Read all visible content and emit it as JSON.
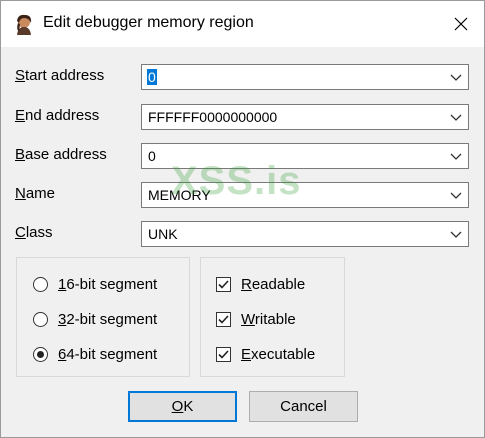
{
  "window": {
    "title": "Edit debugger memory region",
    "icon": "app-avatar-icon",
    "close_icon": "close-icon"
  },
  "fields": {
    "start": {
      "label_accel": "S",
      "label_rest": "tart address",
      "value": "0"
    },
    "end": {
      "label_accel": "E",
      "label_rest": "nd address",
      "value": "FFFFFF0000000000"
    },
    "base": {
      "label_accel": "B",
      "label_rest": "ase address",
      "value": "0"
    },
    "name": {
      "label_accel": "N",
      "label_rest": "ame",
      "value": "MEMORY"
    },
    "class": {
      "label_accel": "C",
      "label_rest": "lass",
      "value": "UNK"
    }
  },
  "segments": {
    "options": [
      {
        "accel": "1",
        "rest": "6-bit segment",
        "selected": false
      },
      {
        "accel": "3",
        "rest": "2-bit segment",
        "selected": false
      },
      {
        "accel": "6",
        "rest": "4-bit segment",
        "selected": true
      }
    ]
  },
  "permissions": {
    "options": [
      {
        "accel": "R",
        "rest": "eadable",
        "checked": true
      },
      {
        "accel": "W",
        "rest": "ritable",
        "checked": true
      },
      {
        "accel": "E",
        "rest": "xecutable",
        "checked": true
      }
    ]
  },
  "buttons": {
    "ok_accel": "O",
    "ok_rest": "K",
    "cancel": "Cancel"
  },
  "watermark": "XSS.is",
  "colors": {
    "accent": "#0078d7",
    "watermark": "#2e9b2e"
  }
}
